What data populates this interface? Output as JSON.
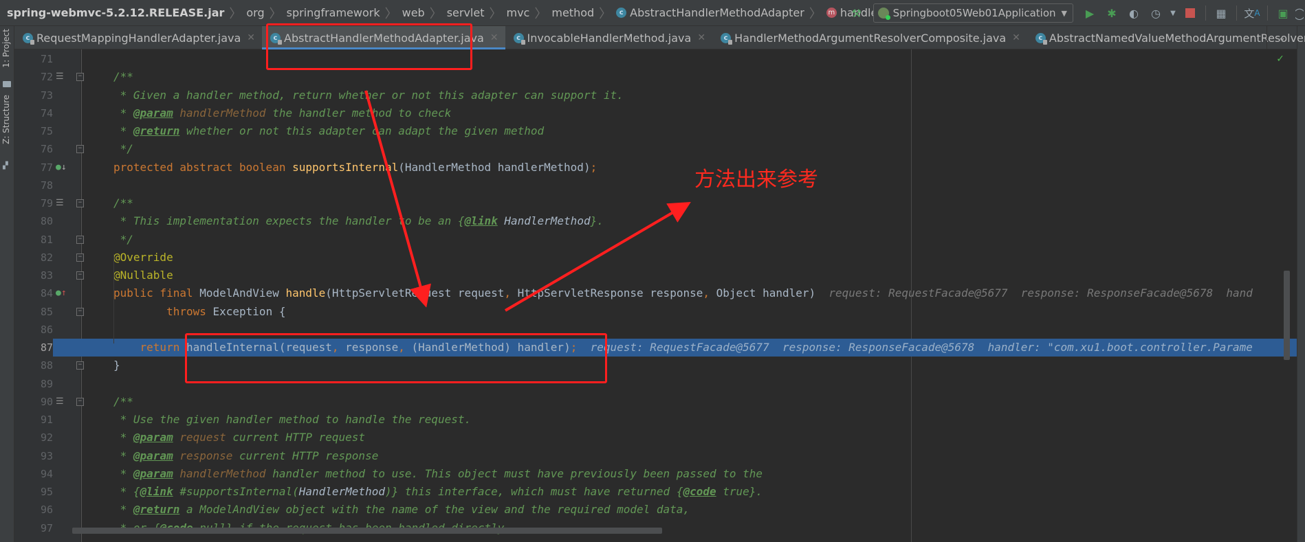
{
  "breadcrumb": {
    "items": [
      {
        "label": "spring-webmvc-5.2.12.RELEASE.jar",
        "icon": "jar"
      },
      {
        "label": "org",
        "icon": ""
      },
      {
        "label": "springframework",
        "icon": ""
      },
      {
        "label": "web",
        "icon": ""
      },
      {
        "label": "servlet",
        "icon": ""
      },
      {
        "label": "mvc",
        "icon": ""
      },
      {
        "label": "method",
        "icon": ""
      },
      {
        "label": "AbstractHandlerMethodAdapter",
        "icon": "class-icon"
      },
      {
        "label": "handle",
        "icon": "method-icon"
      }
    ]
  },
  "toolbar": {
    "build_icon": "hammer-icon",
    "run_config": "Springboot05Web01Application",
    "buttons": [
      "run-icon",
      "debug-icon",
      "coverage-icon",
      "profile-icon",
      "stop-icon",
      "project-structure-icon",
      "translate-icon",
      "terminal-icon"
    ]
  },
  "left_strip": {
    "project_label": "1: Project",
    "structure_label": "Z: Structure"
  },
  "tabs": [
    {
      "label": "RequestMappingHandlerAdapter.java",
      "active": false
    },
    {
      "label": "AbstractHandlerMethodAdapter.java",
      "active": true
    },
    {
      "label": "InvocableHandlerMethod.java",
      "active": false
    },
    {
      "label": "HandlerMethodArgumentResolverComposite.java",
      "active": false
    },
    {
      "label": "AbstractNamedValueMethodArgumentResolver.java",
      "active": false
    }
  ],
  "editor": {
    "current_line": 87,
    "lines": [
      {
        "n": "71"
      },
      {
        "n": "72"
      },
      {
        "n": "73"
      },
      {
        "n": "74"
      },
      {
        "n": "75"
      },
      {
        "n": "76"
      },
      {
        "n": "77"
      },
      {
        "n": "78"
      },
      {
        "n": "79"
      },
      {
        "n": "80"
      },
      {
        "n": "81"
      },
      {
        "n": "82"
      },
      {
        "n": "83"
      },
      {
        "n": "84"
      },
      {
        "n": "85"
      },
      {
        "n": "86"
      },
      {
        "n": "87"
      },
      {
        "n": "88"
      },
      {
        "n": "89"
      },
      {
        "n": "90"
      },
      {
        "n": "91"
      },
      {
        "n": "92"
      },
      {
        "n": "93"
      },
      {
        "n": "94"
      },
      {
        "n": "95"
      },
      {
        "n": "96"
      },
      {
        "n": "97"
      }
    ],
    "text": {
      "l72": "/**",
      "l73": " * Given a handler method, return whether or not this adapter can support it.",
      "l74_star": " * ",
      "l74_tag": "@param",
      "l74_param": " handlerMethod",
      "l74_rest": " the handler method to check",
      "l75_star": " * ",
      "l75_tag": "@return",
      "l75_rest": " whether or not this adapter can adapt the given method",
      "l76": " */",
      "l77_kw": "protected abstract boolean ",
      "l77_fn": "supportsInternal",
      "l77_rest": "(HandlerMethod handlerMethod)",
      "l77_semi": ";",
      "l79": "/**",
      "l80_a": " * This implementation expects the handler to be an {",
      "l80_tag": "@link",
      "l80_ref": " HandlerMethod",
      "l80_b": "}.",
      "l81": " */",
      "l82": "@Override",
      "l83": "@Nullable",
      "l84_kw": "public final ",
      "l84_type": "ModelAndView ",
      "l84_fn": "handle",
      "l84_a": "(HttpServletRequest request",
      "l84_c1": ",",
      "l84_b": " HttpServletResponse response",
      "l84_c2": ",",
      "l84_c": " Object handler)",
      "l84_hint": "  request: RequestFacade@5677  response: ResponseFacade@5678  hand",
      "l85_kw": "        throws ",
      "l85_rest": "Exception {",
      "l87_kw": "    return ",
      "l87_a": "handleInternal(request",
      "l87_c1": ",",
      "l87_b": " response",
      "l87_c2": ",",
      "l87_c": " (HandlerMethod) handler)",
      "l87_semi": ";",
      "l87_hint": "  request: RequestFacade@5677  response: ResponseFacade@5678  handler: \"com.xu1.boot.controller.Parame",
      "l88": "}",
      "l90": "/**",
      "l91": " * Use the given handler method to handle the request.",
      "l92_tag": "@param",
      "l92_param": " request",
      "l92_rest": " current HTTP request",
      "l93_tag": "@param",
      "l93_param": " response",
      "l93_rest": " current HTTP response",
      "l94_tag": "@param",
      "l94_param": " handlerMethod",
      "l94_rest": " handler method to use. This object must have previously been passed to the",
      "l95_a": " * {",
      "l95_tag": "@link",
      "l95_b": " #supportsInternal(",
      "l95_ref": "HandlerMethod",
      "l95_c": ")} this interface, which must have returned {",
      "l95_tag2": "@code",
      "l95_d": " true}.",
      "l96_tag": "@return",
      "l96_rest": " a ModelAndView object with the name of the view and the required model data,",
      "l97_a": " * or {",
      "l97_tag": "@code",
      "l97_b": " null} if the request has been handled directly",
      "star": " * "
    }
  },
  "annotations": {
    "note_text": "方法出来参考",
    "color": "#ff1f1f"
  },
  "colors": {
    "editor_bg": "#2b2b2b",
    "current_line": "#2d5c94",
    "keyword": "#cc7832",
    "doc_comment": "#629755",
    "accent_tab": "#4a88c7"
  }
}
